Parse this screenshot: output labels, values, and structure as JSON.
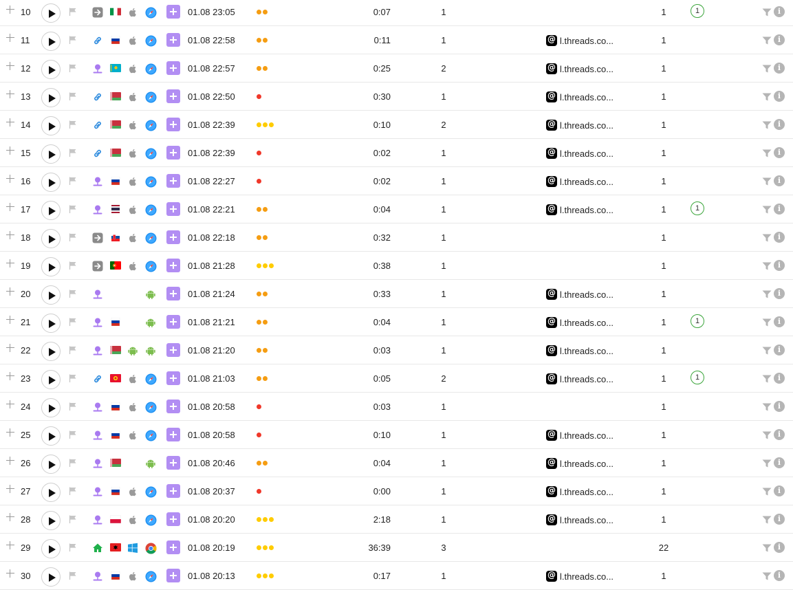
{
  "colors": {
    "dot_orange": "#f59d12",
    "dot_red": "#f0382a",
    "dot_yellow": "#ffcc00",
    "accent_purple": "#b28ef3",
    "goal_green": "#3da63d"
  },
  "rows": [
    {
      "num": "10",
      "source": "direct-icon",
      "country": "italy-flag",
      "os": "apple-icon",
      "browser": "safari-icon",
      "datetime": "01.08 23:05",
      "activity": "orange-2",
      "duration": "0:07",
      "pages": "1",
      "referrer": "",
      "count": "1",
      "goal": "1"
    },
    {
      "num": "11",
      "source": "link-icon",
      "country": "russia-flag",
      "os": "apple-icon",
      "browser": "safari-icon",
      "datetime": "01.08 22:58",
      "activity": "orange-2",
      "duration": "0:11",
      "pages": "1",
      "referrer": "l.threads.co...",
      "count": "1",
      "goal": ""
    },
    {
      "num": "12",
      "source": "social-icon",
      "country": "kazakhstan-flag",
      "os": "apple-icon",
      "browser": "safari-icon",
      "datetime": "01.08 22:57",
      "activity": "orange-2",
      "duration": "0:25",
      "pages": "2",
      "referrer": "l.threads.co...",
      "count": "1",
      "goal": ""
    },
    {
      "num": "13",
      "source": "link-icon",
      "country": "belarus-flag",
      "os": "apple-icon",
      "browser": "safari-icon",
      "datetime": "01.08 22:50",
      "activity": "red-1",
      "duration": "0:30",
      "pages": "1",
      "referrer": "l.threads.co...",
      "count": "1",
      "goal": ""
    },
    {
      "num": "14",
      "source": "link-icon",
      "country": "belarus-flag",
      "os": "apple-icon",
      "browser": "safari-icon",
      "datetime": "01.08 22:39",
      "activity": "yellow-3",
      "duration": "0:10",
      "pages": "2",
      "referrer": "l.threads.co...",
      "count": "1",
      "goal": ""
    },
    {
      "num": "15",
      "source": "link-icon",
      "country": "belarus-flag",
      "os": "apple-icon",
      "browser": "safari-icon",
      "datetime": "01.08 22:39",
      "activity": "red-1",
      "duration": "0:02",
      "pages": "1",
      "referrer": "l.threads.co...",
      "count": "1",
      "goal": ""
    },
    {
      "num": "16",
      "source": "social-icon",
      "country": "russia-flag",
      "os": "apple-icon",
      "browser": "safari-icon",
      "datetime": "01.08 22:27",
      "activity": "red-1",
      "duration": "0:02",
      "pages": "1",
      "referrer": "l.threads.co...",
      "count": "1",
      "goal": ""
    },
    {
      "num": "17",
      "source": "social-icon",
      "country": "thailand-flag",
      "os": "apple-icon",
      "browser": "safari-icon",
      "datetime": "01.08 22:21",
      "activity": "orange-2",
      "duration": "0:04",
      "pages": "1",
      "referrer": "l.threads.co...",
      "count": "1",
      "goal": "1"
    },
    {
      "num": "18",
      "source": "direct-icon",
      "country": "slovakia-flag",
      "os": "apple-icon",
      "browser": "safari-icon",
      "datetime": "01.08 22:18",
      "activity": "orange-2",
      "duration": "0:32",
      "pages": "1",
      "referrer": "",
      "count": "1",
      "goal": ""
    },
    {
      "num": "19",
      "source": "direct-icon",
      "country": "portugal-flag",
      "os": "apple-icon",
      "browser": "safari-icon",
      "datetime": "01.08 21:28",
      "activity": "yellow-3",
      "duration": "0:38",
      "pages": "1",
      "referrer": "",
      "count": "1",
      "goal": ""
    },
    {
      "num": "20",
      "source": "social-icon",
      "country": "",
      "os": "",
      "browser": "android-icon",
      "datetime": "01.08 21:24",
      "activity": "orange-2",
      "duration": "0:33",
      "pages": "1",
      "referrer": "l.threads.co...",
      "count": "1",
      "goal": ""
    },
    {
      "num": "21",
      "source": "social-icon",
      "country": "russia-flag",
      "os": "",
      "browser": "android-icon",
      "datetime": "01.08 21:21",
      "activity": "orange-2",
      "duration": "0:04",
      "pages": "1",
      "referrer": "l.threads.co...",
      "count": "1",
      "goal": "1"
    },
    {
      "num": "22",
      "source": "social-icon",
      "country": "belarus-flag",
      "os": "android-icon",
      "browser": "android-icon",
      "datetime": "01.08 21:20",
      "activity": "orange-2",
      "duration": "0:03",
      "pages": "1",
      "referrer": "l.threads.co...",
      "count": "1",
      "goal": ""
    },
    {
      "num": "23",
      "source": "link-icon",
      "country": "kyrgyzstan-flag",
      "os": "apple-icon",
      "browser": "safari-icon",
      "datetime": "01.08 21:03",
      "activity": "orange-2",
      "duration": "0:05",
      "pages": "2",
      "referrer": "l.threads.co...",
      "count": "1",
      "goal": "1"
    },
    {
      "num": "24",
      "source": "social-icon",
      "country": "russia-flag",
      "os": "apple-icon",
      "browser": "safari-icon",
      "datetime": "01.08 20:58",
      "activity": "red-1",
      "duration": "0:03",
      "pages": "1",
      "referrer": "",
      "count": "1",
      "goal": ""
    },
    {
      "num": "25",
      "source": "social-icon",
      "country": "russia-flag",
      "os": "apple-icon",
      "browser": "safari-icon",
      "datetime": "01.08 20:58",
      "activity": "red-1",
      "duration": "0:10",
      "pages": "1",
      "referrer": "l.threads.co...",
      "count": "1",
      "goal": ""
    },
    {
      "num": "26",
      "source": "social-icon",
      "country": "belarus-flag",
      "os": "",
      "browser": "android-icon",
      "datetime": "01.08 20:46",
      "activity": "orange-2",
      "duration": "0:04",
      "pages": "1",
      "referrer": "l.threads.co...",
      "count": "1",
      "goal": ""
    },
    {
      "num": "27",
      "source": "social-icon",
      "country": "russia-flag",
      "os": "apple-icon",
      "browser": "safari-icon",
      "datetime": "01.08 20:37",
      "activity": "red-1",
      "duration": "0:00",
      "pages": "1",
      "referrer": "l.threads.co...",
      "count": "1",
      "goal": ""
    },
    {
      "num": "28",
      "source": "social-icon",
      "country": "poland-flag",
      "os": "apple-icon",
      "browser": "safari-icon",
      "datetime": "01.08 20:20",
      "activity": "yellow-3",
      "duration": "2:18",
      "pages": "1",
      "referrer": "l.threads.co...",
      "count": "1",
      "goal": ""
    },
    {
      "num": "29",
      "source": "home-icon",
      "country": "albania-flag",
      "os": "windows-icon",
      "browser": "chrome-icon",
      "datetime": "01.08 20:19",
      "activity": "yellow-3",
      "duration": "36:39",
      "pages": "3",
      "referrer": "",
      "count": "22",
      "goal": ""
    },
    {
      "num": "30",
      "source": "social-icon",
      "country": "russia-flag",
      "os": "apple-icon",
      "browser": "safari-icon",
      "datetime": "01.08 20:13",
      "activity": "yellow-3",
      "duration": "0:17",
      "pages": "1",
      "referrer": "l.threads.co...",
      "count": "1",
      "goal": ""
    }
  ]
}
